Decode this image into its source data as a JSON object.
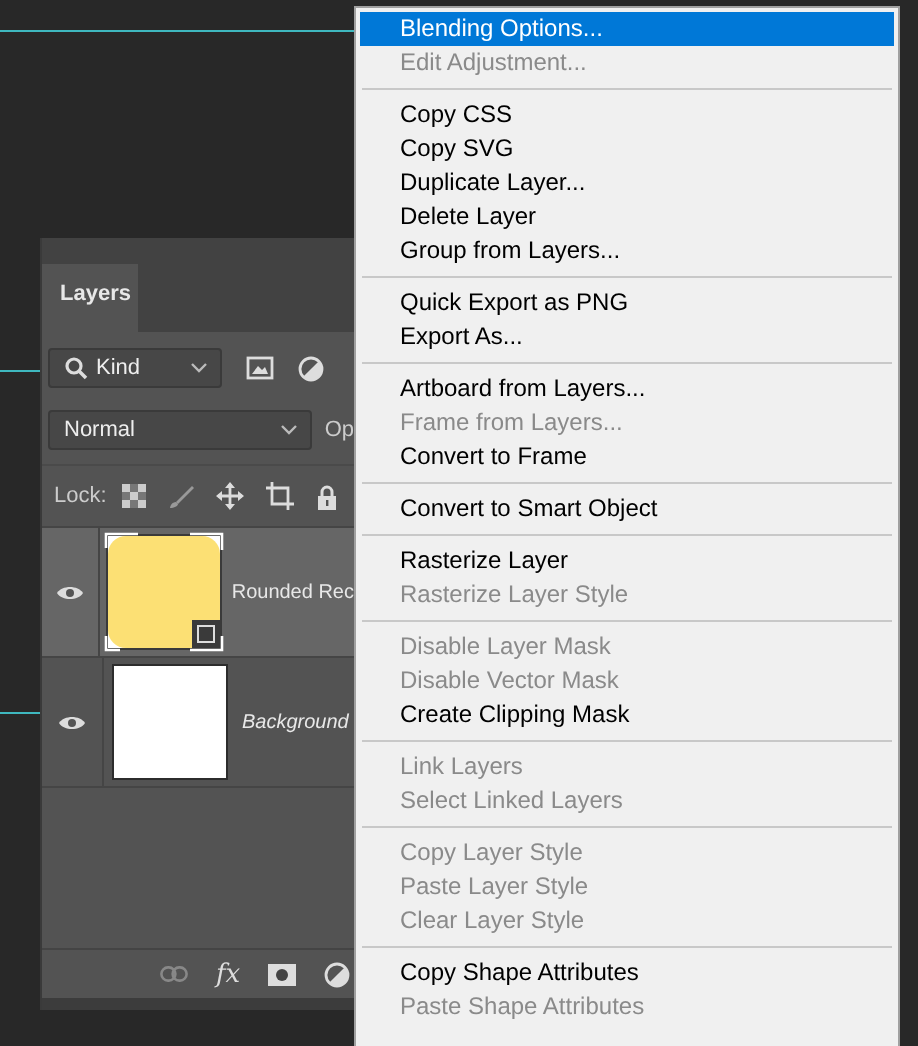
{
  "layers_panel": {
    "tab": {
      "label": "Layers",
      "selected": true
    },
    "filter": {
      "value": "Kind"
    },
    "blend_mode": {
      "value": "Normal"
    },
    "opacity_label": "Op",
    "lock_label": "Lock:",
    "effects_label": "fx",
    "layers": [
      {
        "name": "Rounded Rec",
        "kind": "shape",
        "selected": true,
        "visible": true
      },
      {
        "name": "Background",
        "kind": "background",
        "selected": false,
        "visible": true
      }
    ]
  },
  "context_menu": {
    "groups": [
      [
        {
          "label": "Blending Options...",
          "selected": true,
          "disabled": false
        },
        {
          "label": "Edit Adjustment...",
          "selected": false,
          "disabled": true
        }
      ],
      [
        {
          "label": "Copy CSS",
          "selected": false,
          "disabled": false
        },
        {
          "label": "Copy SVG",
          "selected": false,
          "disabled": false
        },
        {
          "label": "Duplicate Layer...",
          "selected": false,
          "disabled": false
        },
        {
          "label": "Delete Layer",
          "selected": false,
          "disabled": false
        },
        {
          "label": "Group from Layers...",
          "selected": false,
          "disabled": false
        }
      ],
      [
        {
          "label": "Quick Export as PNG",
          "selected": false,
          "disabled": false
        },
        {
          "label": "Export As...",
          "selected": false,
          "disabled": false
        }
      ],
      [
        {
          "label": "Artboard from Layers...",
          "selected": false,
          "disabled": false
        },
        {
          "label": "Frame from Layers...",
          "selected": false,
          "disabled": true
        },
        {
          "label": "Convert to Frame",
          "selected": false,
          "disabled": false
        }
      ],
      [
        {
          "label": "Convert to Smart Object",
          "selected": false,
          "disabled": false
        }
      ],
      [
        {
          "label": "Rasterize Layer",
          "selected": false,
          "disabled": false
        },
        {
          "label": "Rasterize Layer Style",
          "selected": false,
          "disabled": true
        }
      ],
      [
        {
          "label": "Disable Layer Mask",
          "selected": false,
          "disabled": true
        },
        {
          "label": "Disable Vector Mask",
          "selected": false,
          "disabled": true
        },
        {
          "label": "Create Clipping Mask",
          "selected": false,
          "disabled": false
        }
      ],
      [
        {
          "label": "Link Layers",
          "selected": false,
          "disabled": true
        },
        {
          "label": "Select Linked Layers",
          "selected": false,
          "disabled": true
        }
      ],
      [
        {
          "label": "Copy Layer Style",
          "selected": false,
          "disabled": true
        },
        {
          "label": "Paste Layer Style",
          "selected": false,
          "disabled": true
        },
        {
          "label": "Clear Layer Style",
          "selected": false,
          "disabled": true
        }
      ],
      [
        {
          "label": "Copy Shape Attributes",
          "selected": false,
          "disabled": false
        },
        {
          "label": "Paste Shape Attributes",
          "selected": false,
          "disabled": true
        }
      ]
    ]
  }
}
